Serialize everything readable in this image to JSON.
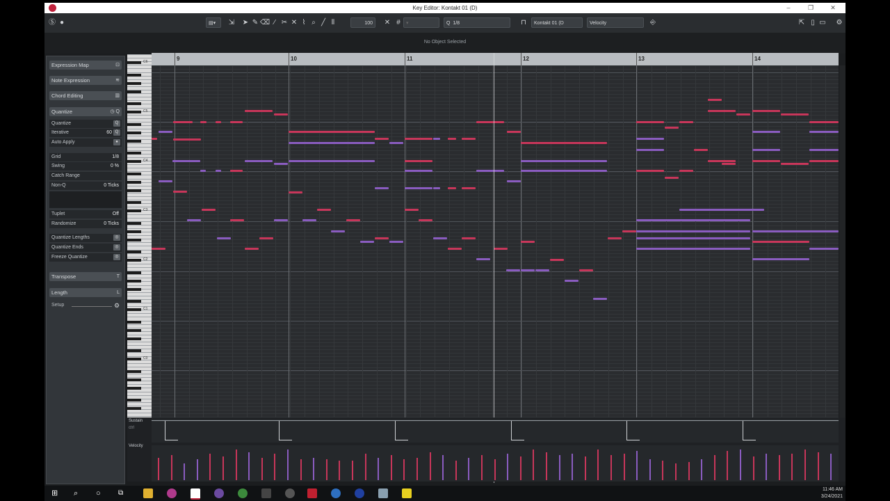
{
  "window": {
    "title": "Key Editor: Kontakt 01 (D)"
  },
  "toolbar": {
    "velocity_value": "100",
    "quantize_label": "Q",
    "quantize_value": "1/8",
    "instrument": "Kontakt 01 (D",
    "controller": "Velocity"
  },
  "status": {
    "message": "No Object Selected"
  },
  "inspector": {
    "expression_map": "Expression Map",
    "note_expression": "Note Expression",
    "chord_editing": "Chord Editing",
    "quantize_section": "Quantize",
    "quantize_row": "Quantize",
    "iterative": "Iterative",
    "iterative_value": "60",
    "auto_apply": "Auto Apply",
    "grid": "Grid",
    "grid_value": "1/8",
    "swing": "Swing",
    "swing_value": "0 %",
    "catch_range": "Catch Range",
    "non_q": "Non-Q",
    "non_q_value": "0 Ticks",
    "tuplet": "Tuplet",
    "tuplet_value": "Off",
    "randomize": "Randomize",
    "randomize_value": "0 Ticks",
    "quantize_lengths": "Quantize Lengths",
    "quantize_ends": "Quantize Ends",
    "freeze_quantize": "Freeze Quantize",
    "transpose": "Transpose",
    "length": "Length",
    "setup": "Setup"
  },
  "ruler": {
    "bars": [
      "9",
      "10",
      "11",
      "12",
      "13",
      "14"
    ]
  },
  "keyboard": {
    "octaves": [
      "C6",
      "C5",
      "C4",
      "C3",
      "C2",
      "C1",
      "C0"
    ]
  },
  "lanes": {
    "sustain": "Sustain",
    "sustain_sub": "ctrl",
    "velocity": "Velocity"
  },
  "taskbar": {
    "time": "11:46 AM",
    "date": "3/24/2021"
  },
  "colors": {
    "note_red": "#c8365a",
    "note_purple": "#8a5cc0",
    "accent": "#c0223c"
  }
}
